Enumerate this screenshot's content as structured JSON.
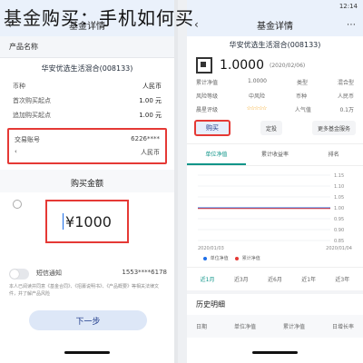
{
  "headline": {
    "text": "基金购买：手机如何买",
    "ghost": "基金"
  },
  "left_phone": {
    "title": "基金详情",
    "section_fund": "产品名称",
    "fund_name": "华安优选生活混合(008133)",
    "fields": [
      {
        "label": "币种",
        "value": "人民币"
      },
      {
        "label": "首次购买起点",
        "value": "1.00 元"
      },
      {
        "label": "追加购买起点",
        "value": "1.00 元"
      }
    ],
    "trade_account_label": "交易账号",
    "trade_account_value": "6226****",
    "currency_label": "人民币",
    "amount_title": "购买金额",
    "amount_value": "¥1000",
    "fineprint": "本人已阅读并同意《基金合同》、《招募说明书》、《产品概要》等相关法律文件，并了解产品风险",
    "notice_label": "短信通知",
    "notice_value": "1553****6178",
    "next_button": "下一步"
  },
  "right_phone": {
    "status_time": "12:14",
    "title": "基金详情",
    "fund_name": "华安优选生活混合(008133)",
    "nav_value": "1.0000",
    "nav_date": "(2020/02/06)",
    "rows": [
      {
        "label": "累计净值",
        "value": "1.0000"
      },
      {
        "label": "类型",
        "value": "混合型"
      },
      {
        "label": "风险等级",
        "value": "中风险"
      },
      {
        "label": "币种",
        "value": "人民币"
      },
      {
        "label": "晨星评级",
        "value": "☆☆☆☆☆"
      },
      {
        "label": "人气值",
        "value": "0.1万"
      }
    ],
    "buy_button": "购买",
    "fixed_button": "定投",
    "more_button": "更多基金服务",
    "tabs": [
      "单位净值",
      "累计收益率",
      "排名"
    ],
    "chart_dates": [
      "2020/01/03",
      "2020/01/04"
    ],
    "legend": [
      "单位净值",
      "累计净值"
    ],
    "range_tabs": [
      "近1月",
      "近3月",
      "近6月",
      "近1年",
      "近3年"
    ],
    "history_title": "历史明细",
    "history_head": [
      "日期",
      "单位净值",
      "累计净值",
      "日增长率"
    ]
  },
  "chart_data": {
    "type": "line",
    "y_ticks": [
      "1.15",
      "1.10",
      "1.05",
      "1.00",
      "0.95",
      "0.90",
      "0.85"
    ],
    "series": [
      {
        "name": "单位净值",
        "color": "#1e6fe8",
        "values": [
          1.0,
          1.0
        ]
      },
      {
        "name": "累计净值",
        "color": "#e53935",
        "values": [
          1.0,
          1.0
        ]
      }
    ],
    "x": [
      "2020/01/03",
      "2020/01/04"
    ]
  }
}
